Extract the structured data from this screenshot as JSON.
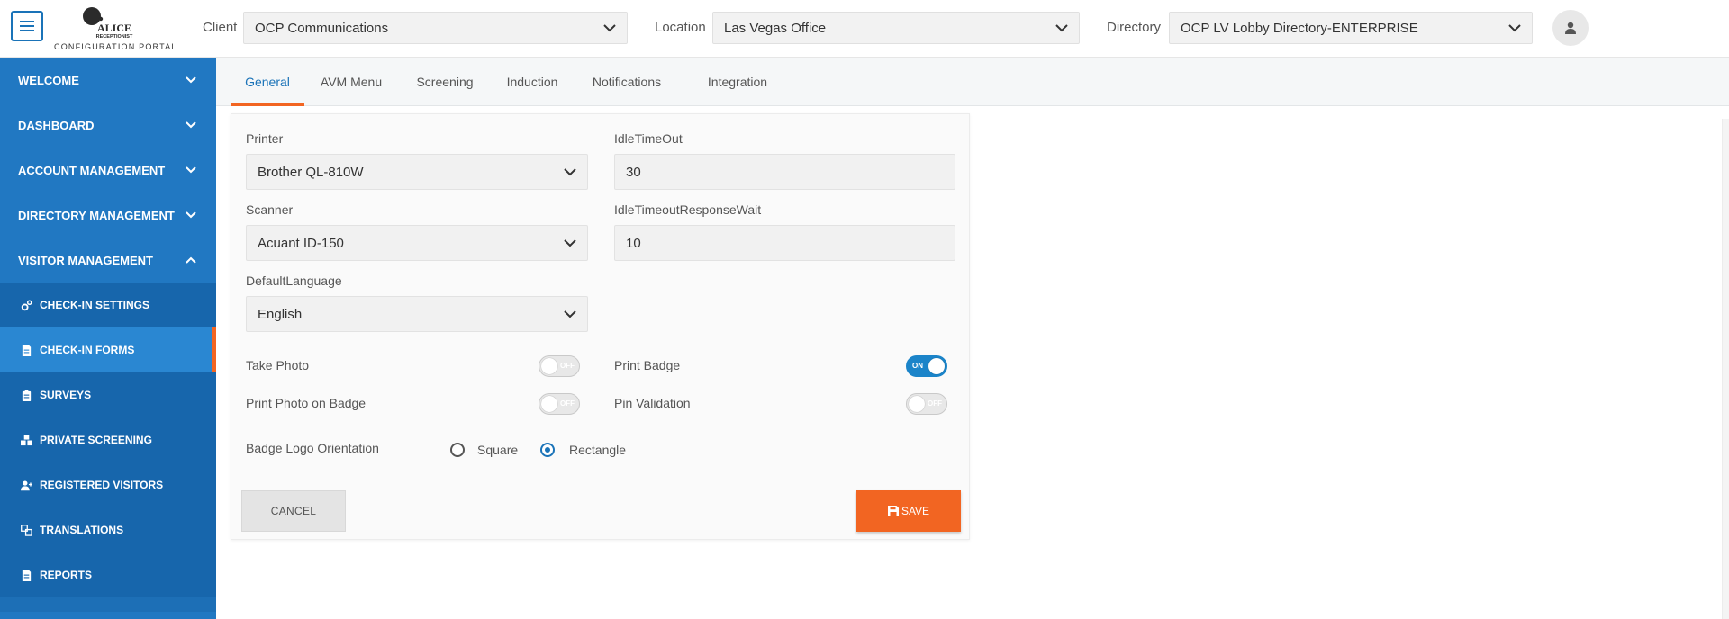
{
  "header": {
    "logo_text": "ALICE RECEPTIONIST",
    "logo_sub": "CONFIGURATION PORTAL",
    "client_label": "Client",
    "client_value": "OCP Communications",
    "location_label": "Location",
    "location_value": "Las Vegas Office",
    "directory_label": "Directory",
    "directory_value": "OCP LV Lobby Directory-ENTERPRISE"
  },
  "sidebar": {
    "main_items": [
      {
        "label": "WELCOME"
      },
      {
        "label": "DASHBOARD"
      },
      {
        "label": "ACCOUNT MANAGEMENT"
      },
      {
        "label": "DIRECTORY MANAGEMENT"
      },
      {
        "label": "VISITOR MANAGEMENT"
      }
    ],
    "sub_items": [
      {
        "label": "CHECK-IN SETTINGS",
        "icon": "gears-icon"
      },
      {
        "label": "CHECK-IN FORMS",
        "icon": "form-document-icon",
        "active": true
      },
      {
        "label": "SURVEYS",
        "icon": "clipboard-icon"
      },
      {
        "label": "PRIVATE SCREENING",
        "icon": "boxes-icon"
      },
      {
        "label": "REGISTERED VISITORS",
        "icon": "user-plus-icon"
      },
      {
        "label": "TRANSLATIONS",
        "icon": "translate-icon"
      },
      {
        "label": "REPORTS",
        "icon": "report-document-icon"
      }
    ]
  },
  "tabs": [
    {
      "label": "General",
      "active": true
    },
    {
      "label": "AVM Menu"
    },
    {
      "label": "Screening"
    },
    {
      "label": "Induction"
    },
    {
      "label": "Notifications"
    },
    {
      "label": "Integration"
    }
  ],
  "form": {
    "printer_label": "Printer",
    "printer_value": "Brother QL-810W",
    "idle_timeout_label": "IdleTimeOut",
    "idle_timeout_value": "30",
    "scanner_label": "Scanner",
    "scanner_value": "Acuant ID-150",
    "idle_wait_label": "IdleTimeoutResponseWait",
    "idle_wait_value": "10",
    "default_language_label": "DefaultLanguage",
    "default_language_value": "English",
    "take_photo_label": "Take Photo",
    "take_photo_state": "OFF",
    "print_badge_label": "Print Badge",
    "print_badge_state": "ON",
    "print_photo_label": "Print Photo on Badge",
    "print_photo_state": "OFF",
    "pin_validation_label": "Pin Validation",
    "pin_validation_state": "OFF",
    "badge_logo_label": "Badge Logo Orientation",
    "orientation_square": "Square",
    "orientation_rectangle": "Rectangle",
    "orientation_selected": "Rectangle"
  },
  "buttons": {
    "cancel": "CANCEL",
    "save": "SAVE"
  },
  "colors": {
    "sidebar": "#1d6fb6",
    "accent": "#f26522",
    "toggle_on": "#1b84c9"
  }
}
